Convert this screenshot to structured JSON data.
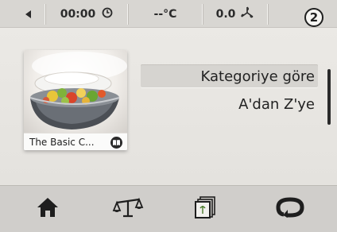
{
  "status_bar": {
    "back_icon": "back-triangle-icon",
    "time": "00:00",
    "time_icon": "clock-icon",
    "temperature": "--°C",
    "speed": "0.0",
    "speed_icon": "fan-icon",
    "step": "2"
  },
  "book": {
    "title": "The Basic C...",
    "badge_icon": "book-icon"
  },
  "menu": {
    "items": [
      {
        "label": "Kategoriye göre",
        "selected": true
      },
      {
        "label": "A'dan Z'ye",
        "selected": false
      }
    ]
  },
  "bottom_nav": {
    "home_icon": "home-icon",
    "scale_icon": "scale-icon",
    "cookbook_icon": "cookbook-icon",
    "mode_icon": "mode-icon"
  },
  "colors": {
    "background": "#e7e5e1",
    "status_bar": "#d8d6d2",
    "bottom_bar": "#d0cecb",
    "selected_item": "#d6d4d0",
    "text": "#222222"
  }
}
